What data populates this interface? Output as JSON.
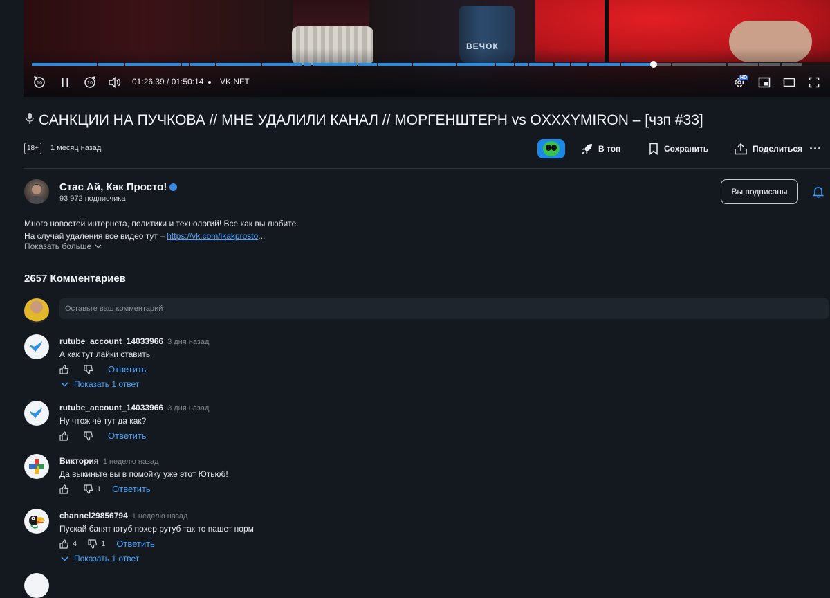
{
  "player": {
    "time": "01:26:39 / 01:50:14",
    "separator": "•",
    "brand": "VK NFT",
    "mug_text": "ВЕЧОК",
    "hd_badge": "HD",
    "progress": 0.808,
    "colors": {
      "played": "#1e8fea",
      "unplayed": "#5a5f66",
      "accent": "#2f6edc"
    }
  },
  "video": {
    "title": "САНКЦИИ НА ПУЧКОВА // МНЕ УДАЛИЛИ КАНАЛ // МОРГЕНШТЕРН vs OXXXYMIRON – [чзп #33]",
    "age_rating": "18+",
    "published": "1 месяц назад",
    "actions": {
      "top": "В топ",
      "save": "Сохранить",
      "share": "Поделиться"
    }
  },
  "channel": {
    "name": "Стас Ай, Как Просто!",
    "subscribers": "93 972 подписчика",
    "subscribe_label": "Вы подписаны",
    "description_line1": "Много новостей интернета, политики и технологий! Все как вы любите.",
    "description_line2_prefix": "На случай удаления все видео тут – ",
    "description_link": "https://vk.com/ikakprosto",
    "description_ellipsis": "...",
    "show_more": "Показать больше"
  },
  "comments": {
    "count_label": "2657 Комментариев",
    "input_placeholder": "Оставьте ваш комментарий",
    "reply_label": "Ответить",
    "show_replies_label": "Показать 1 ответ",
    "items": [
      {
        "author": "rutube_account_14033966",
        "time": "3 дня назад",
        "text": "А как тут лайки ставить",
        "likes": "",
        "dislikes": "",
        "avatar": "bird-icon"
      },
      {
        "author": "rutube_account_14033966",
        "time": "3 дня назад",
        "text": "Ну чтож чё тут да как?",
        "likes": "",
        "dislikes": "",
        "avatar": "bird-icon"
      },
      {
        "author": "Виктория",
        "time": "1 неделю назад",
        "text": "Да выкиньте вы в помойку уже этот Ютьюб!",
        "likes": "",
        "dislikes": "1",
        "avatar": "plus-icon"
      },
      {
        "author": "channel29856794",
        "time": "1 неделю назад",
        "text": "Пускай банят ютуб похер рутуб так то пашет норм",
        "likes": "4",
        "dislikes": "1",
        "avatar": "toucan-icon"
      }
    ]
  }
}
